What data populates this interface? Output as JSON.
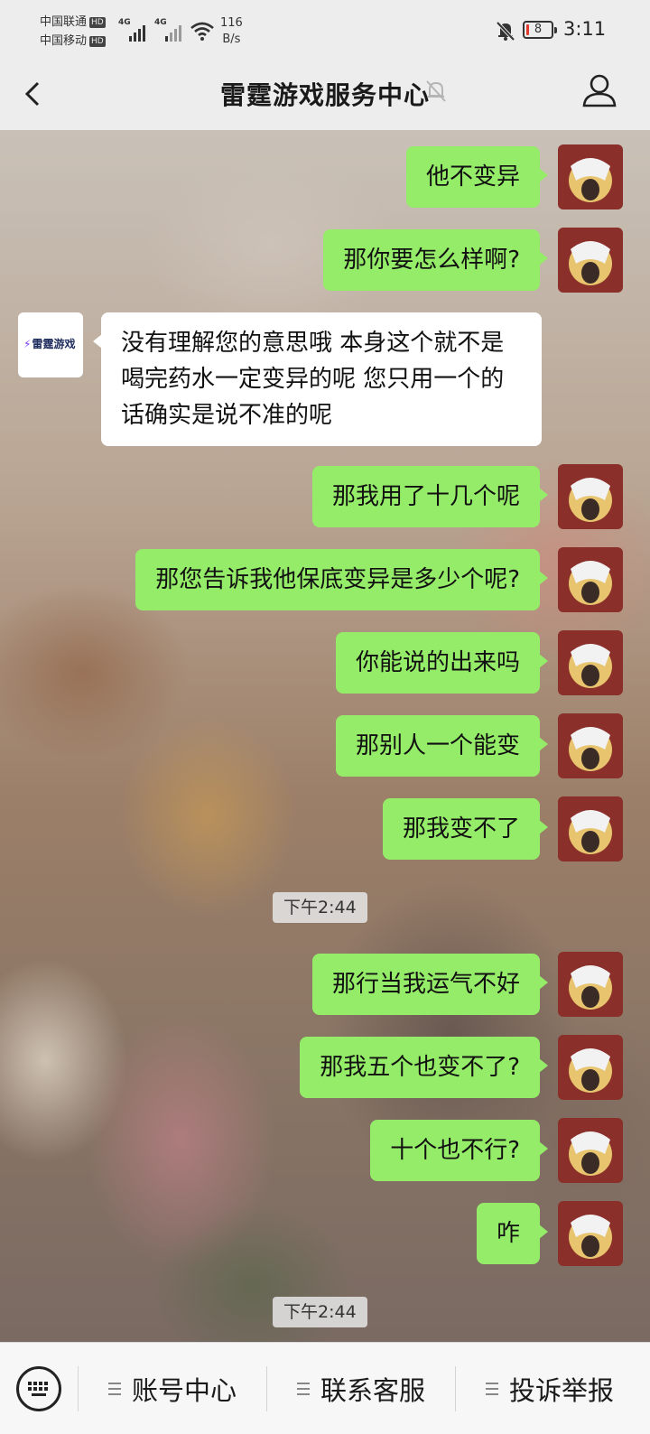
{
  "status_bar": {
    "carrier1": "中国联通",
    "carrier2": "中国移动",
    "hd": "HD",
    "net1": "4G",
    "net2": "4G",
    "speed_value": "116",
    "speed_unit": "B/s",
    "battery": "8",
    "time": "3:11"
  },
  "header": {
    "title": "雷霆游戏服务中心"
  },
  "bot": {
    "logo_text": "雷霆游戏"
  },
  "messages": [
    {
      "from": "me",
      "text": "他不变异"
    },
    {
      "from": "me",
      "text": "那你要怎么样啊?"
    },
    {
      "from": "bot",
      "text": "没有理解您的意思哦 本身这个就不是喝完药水一定变异的呢 您只用一个的话确实是说不准的呢"
    },
    {
      "from": "me",
      "text": "那我用了十几个呢"
    },
    {
      "from": "me",
      "text": "那您告诉我他保底变异是多少个呢?"
    },
    {
      "from": "me",
      "text": "你能说的出来吗"
    },
    {
      "from": "me",
      "text": "那别人一个能变"
    },
    {
      "from": "me",
      "text": "那我变不了"
    },
    {
      "from": "me",
      "text": "那行当我运气不好"
    },
    {
      "from": "me",
      "text": "那我五个也变不了?"
    },
    {
      "from": "me",
      "text": "十个也不行?"
    },
    {
      "from": "me",
      "text": "咋"
    }
  ],
  "timestamps": [
    "下午2:44",
    "下午2:44"
  ],
  "menu": [
    {
      "label": "账号中心"
    },
    {
      "label": "联系客服"
    },
    {
      "label": "投诉举报"
    }
  ],
  "colors": {
    "my_bubble": "#95ec69",
    "bot_bubble": "#ffffff",
    "bar_bg": "#ededed"
  }
}
